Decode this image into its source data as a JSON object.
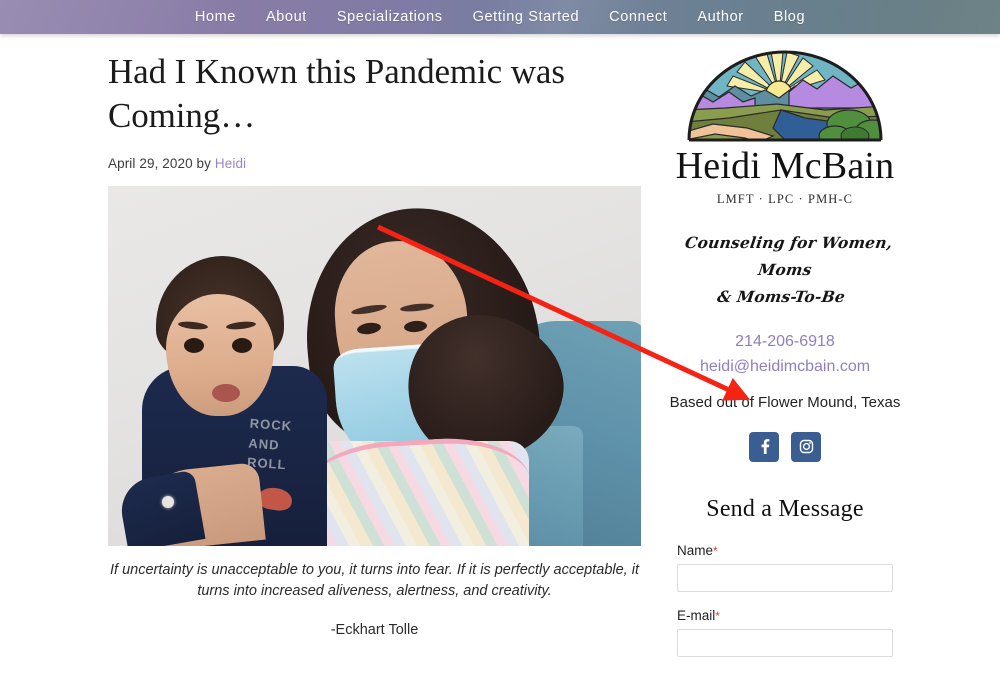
{
  "nav": {
    "items": [
      {
        "label": "Home"
      },
      {
        "label": "About"
      },
      {
        "label": "Specializations"
      },
      {
        "label": "Getting Started"
      },
      {
        "label": "Connect"
      },
      {
        "label": "Author"
      },
      {
        "label": "Blog"
      }
    ]
  },
  "post": {
    "title": "Had I Known this Pandemic was Coming…",
    "date": "April 29, 2020 by",
    "author": "Heidi",
    "image_alt": "woman wearing a blue surgical mask holding a toddler in a navy shirt",
    "shirt_text": "ROCK AND ROLL",
    "caption": "If uncertainty is unacceptable to you, it turns into fear. If it is perfectly acceptable, it turns into increased aliveness, alertness, and creativity.",
    "caption_author": "-Eckhart Tolle"
  },
  "annotation": {
    "arrow_color": "#f42314",
    "points_to": "facebook-social-button"
  },
  "sidebar": {
    "logo": {
      "name": "Heidi McBain",
      "credentials": "LMFT  ·  LPC  ·  PMH-C"
    },
    "tagline_line1": "Counseling for Women, Moms",
    "tagline_line2": "& Moms-To-Be",
    "phone": "214-206-6918",
    "email": "heidi@heidimcbain.com",
    "location": "Based out of Flower Mound, Texas",
    "socials": [
      {
        "name": "facebook",
        "glyph": "f"
      },
      {
        "name": "instagram",
        "glyph": "instagram-icon"
      }
    ],
    "form": {
      "title": "Send a Message",
      "name_label": "Name",
      "name_value": "",
      "email_label": "E-mail",
      "email_value": "",
      "required_mark": "*"
    }
  },
  "colors": {
    "nav_gradient_start": "#8e80ab",
    "nav_gradient_end": "#738a8d",
    "link_purple": "#8f7fc0",
    "social_blue": "#3b5e92",
    "required_red": "#e23b2e",
    "arrow_red": "#f42314"
  }
}
